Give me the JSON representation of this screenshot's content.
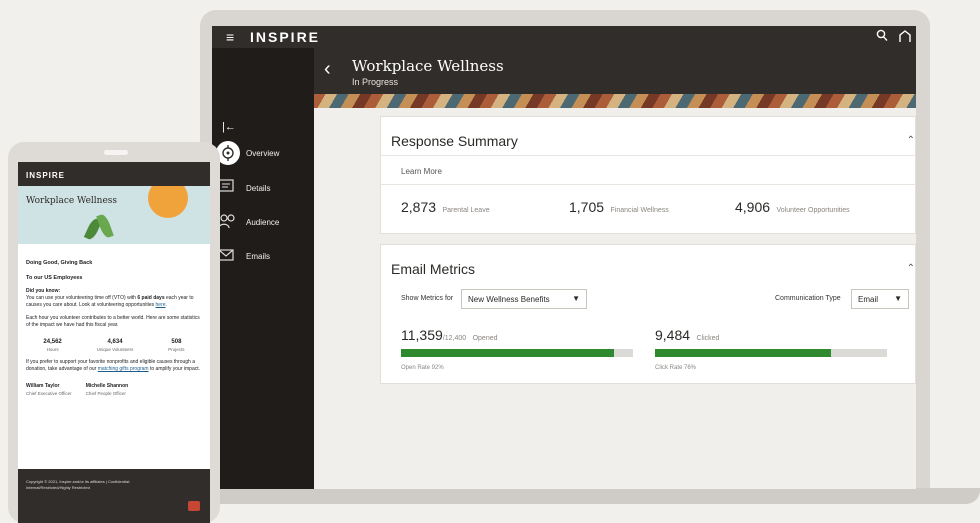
{
  "app": {
    "brand": "INSPIRE",
    "page_title": "Workplace Wellness",
    "page_status": "In Progress",
    "nav": [
      {
        "label": "Overview",
        "icon": "overview-icon",
        "active": true
      },
      {
        "label": "Details",
        "icon": "details-icon"
      },
      {
        "label": "Audience",
        "icon": "audience-icon"
      },
      {
        "label": "Emails",
        "icon": "email-icon"
      }
    ]
  },
  "response_summary": {
    "title": "Response Summary",
    "learn_more": "Learn More",
    "stats": [
      {
        "value": "2,873",
        "label": "Parental Leave"
      },
      {
        "value": "1,705",
        "label": "Financial Wellness"
      },
      {
        "value": "4,906",
        "label": "Volunteer Opportunities"
      }
    ]
  },
  "email_metrics": {
    "title": "Email Metrics",
    "show_metrics_label": "Show Metrics for",
    "show_metrics_value": "New Wellness Benefits",
    "comm_type_label": "Communication Type",
    "comm_type_value": "Email",
    "opened": {
      "value": "11,359",
      "total": "/12,400",
      "label": "Opened",
      "rate": "Open Rate 92%",
      "fraction": 0.92
    },
    "clicked": {
      "value": "9,484",
      "label": "Clicked",
      "rate": "Click Rate 76%",
      "fraction": 0.76
    }
  },
  "email": {
    "brand": "INSPIRE",
    "hero_title": "Workplace Wellness",
    "heading": "Doing Good, Giving Back",
    "salutation": "To our US Employees",
    "did_you_know": "Did you know:",
    "p1_a": "You can use your volunteering time off (VTO) with ",
    "p1_b": "6 paid days",
    "p1_c": " each year to causes you care about. Look at volunteering opportunities ",
    "p1_link": "here",
    "p2": "Each hour you volunteer contributes to a better world. Here are some statistics of the impact we have had this fiscal year.",
    "stats": [
      {
        "value": "24,562",
        "label": "Hours"
      },
      {
        "value": "4,634",
        "label": "Unique Volunteers"
      },
      {
        "value": "508",
        "label": "Projects"
      }
    ],
    "p3_a": "If you prefer to support your favorite nonprofits and eligible causes through a donation, take advantage of our ",
    "p3_link": "matching gifts program",
    "p3_b": " to amplify your impact.",
    "signers": [
      {
        "name": "William Taylor",
        "title": "Chief Executive Officer"
      },
      {
        "name": "Michelle Shannon",
        "title": "Chief People Officer"
      }
    ],
    "footer_1": "Copyright © 2021, Inspire and/or its affiliates | Confidential:",
    "footer_2": "Internal/Restricted/Highly Restricted"
  }
}
